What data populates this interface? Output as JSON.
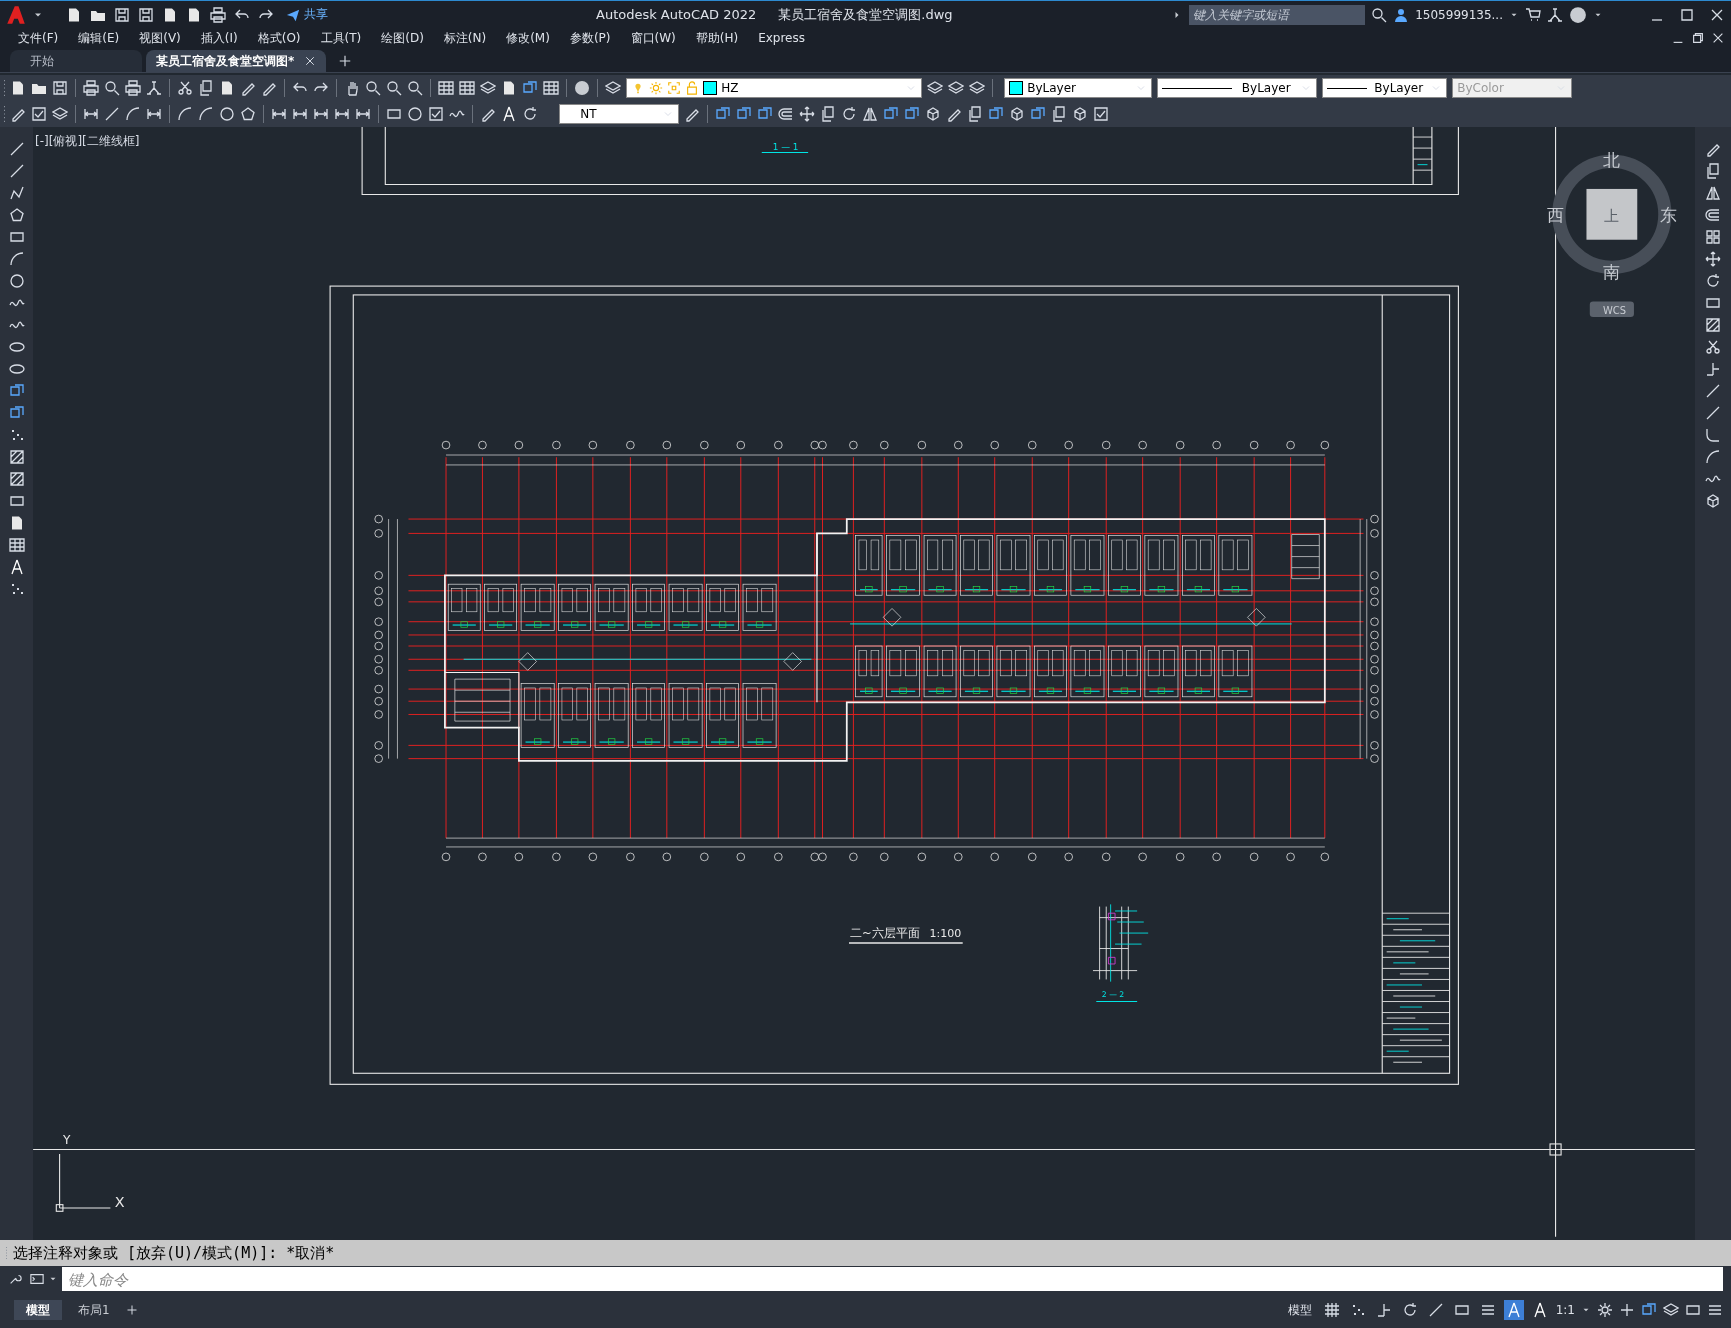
{
  "title_bar": {
    "share_label": "共享",
    "app_name": "Autodesk AutoCAD 2022",
    "file_name": "某员工宿舍及食堂空调图.dwg",
    "search": {
      "placeholder": "键入关键字或短语"
    },
    "user": "1505999135..."
  },
  "menu": [
    "文件(F)",
    "编辑(E)",
    "视图(V)",
    "插入(I)",
    "格式(O)",
    "工具(T)",
    "绘图(D)",
    "标注(N)",
    "修改(M)",
    "参数(P)",
    "窗口(W)",
    "帮助(H)",
    "Express"
  ],
  "tabs": [
    {
      "label": "开始",
      "selected": false
    },
    {
      "label": "某员工宿舍及食堂空调图*",
      "selected": true
    }
  ],
  "toolbar": {
    "layer": "HZ",
    "color_setting": "ByLayer",
    "linetype": "ByLayer",
    "lineweight": "ByLayer",
    "plot_style": {
      "value": "ByColor",
      "disabled": true
    },
    "text_style": "NT"
  },
  "viewport_label": "[-][俯视][二维线框]",
  "view_cube": {
    "north": "北",
    "south": "南",
    "west": "西",
    "east": "东",
    "face": "上",
    "ucs": "WCS"
  },
  "drawing": {
    "top_section_label": "1 — 1",
    "plan_title": "二~六层平面",
    "plan_scale": "1:100",
    "section_label": "2 — 2"
  },
  "ucs_icon": {
    "x_label": "X",
    "y_label": "Y"
  },
  "command": {
    "history": "选择注释对象或 [放弃(U)/模式(M)]: *取消*",
    "placeholder": "键入命令"
  },
  "layout_tabs": [
    {
      "label": "模型",
      "selected": true
    },
    {
      "label": "布局1",
      "selected": false
    }
  ],
  "status_bar": {
    "space": "模型",
    "annotation_scale": "1:1",
    "toggles": [
      {
        "kind": "grid",
        "on": false
      },
      {
        "kind": "snap",
        "on": false
      },
      {
        "kind": "ortho",
        "on": false
      },
      {
        "kind": "polar",
        "on": false
      },
      {
        "kind": "isodraft",
        "on": false
      },
      {
        "kind": "osnap",
        "on": false
      },
      {
        "kind": "lineweight",
        "on": false
      },
      {
        "kind": "annotation",
        "on": true
      },
      {
        "kind": "autoscale",
        "on": false
      }
    ]
  }
}
